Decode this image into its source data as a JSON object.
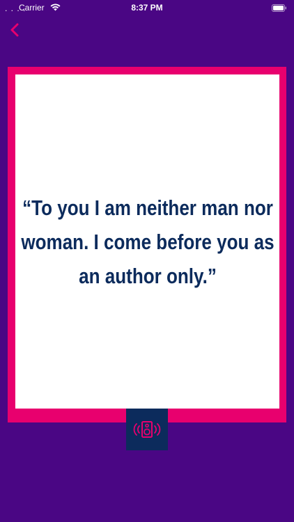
{
  "status_bar": {
    "signal": ". . . .",
    "carrier": "Carrier",
    "time": "8:37 PM"
  },
  "quote": {
    "text": "“To you I am neither man nor woman. I come before you as an author only.”"
  },
  "icons": {
    "back": "chevron-left-icon",
    "speaker": "speaker-sound-icon",
    "wifi": "wifi-icon",
    "battery": "battery-icon"
  },
  "colors": {
    "background": "#4a0684",
    "frame": "#e8006e",
    "card": "#ffffff",
    "quote_text": "#0c2b5c",
    "speaker_button": "#0c2b5c",
    "accent": "#e8006e"
  }
}
